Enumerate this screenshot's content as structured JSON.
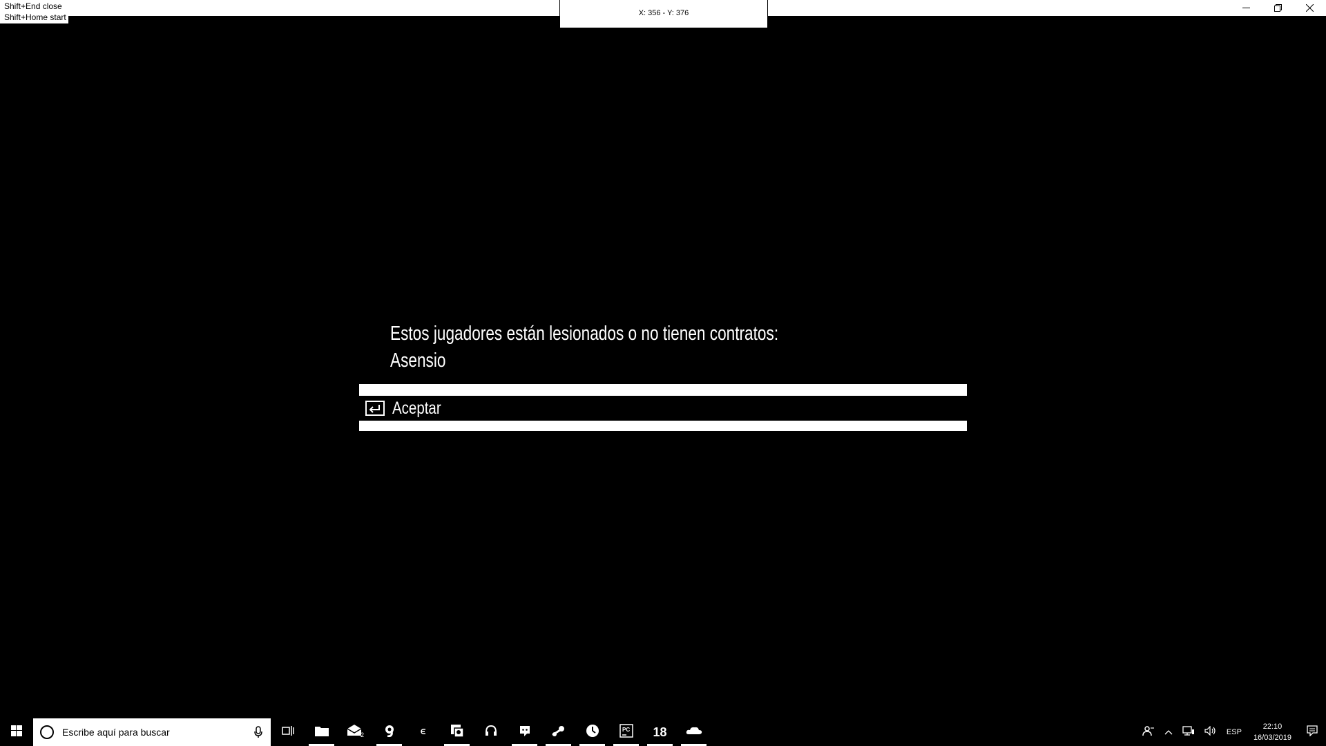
{
  "overlay": {
    "hotkey_close": "Shift+End close",
    "hotkey_start": "Shift+Home start",
    "coordinate_readout": "X: 356 - Y: 376"
  },
  "window_controls": {
    "minimize_icon": "minimize-icon",
    "restore_icon": "restore-icon",
    "close_icon": "close-icon"
  },
  "dialog": {
    "message": "Estos jugadores están lesionados o no tienen contratos:",
    "player": "Asensio",
    "accept_label": "Aceptar",
    "accept_icon": "enter-key-icon"
  },
  "taskbar": {
    "search_placeholder": "Escribe aquí para buscar",
    "apps": [
      {
        "name": "task-view-icon",
        "active": false
      },
      {
        "name": "file-explorer-icon",
        "active": true
      },
      {
        "name": "mail-icon",
        "active": false
      },
      {
        "name": "app-icon",
        "active": true
      },
      {
        "name": "epic-games-icon",
        "active": false
      },
      {
        "name": "game-launcher-icon",
        "active": true
      },
      {
        "name": "headset-icon",
        "active": false
      },
      {
        "name": "discord-icon",
        "active": true
      },
      {
        "name": "steam-icon",
        "active": true
      },
      {
        "name": "clock-app-icon",
        "active": true
      },
      {
        "name": "pycharm-icon",
        "active": true
      },
      {
        "name": "app-18-icon",
        "active": true,
        "label": "18"
      },
      {
        "name": "cloud-icon",
        "active": true
      }
    ],
    "tray": {
      "people_icon": "people-icon",
      "chevron_icon": "chevron-up-icon",
      "network_icon": "network-icon",
      "volume_icon": "volume-icon",
      "language": "ESP",
      "time": "22:10",
      "date": "16/03/2019",
      "notifications_icon": "notifications-icon"
    }
  }
}
